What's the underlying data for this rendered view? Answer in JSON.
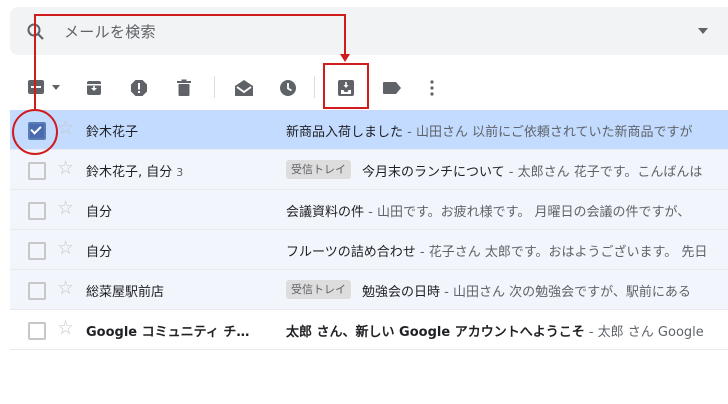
{
  "search": {
    "placeholder": "メールを検索"
  },
  "toolbar": {
    "buttons": [
      "select-all",
      "archive",
      "report-spam",
      "delete",
      "mark-as-read",
      "snooze",
      "move-to-inbox",
      "label",
      "more"
    ]
  },
  "colors": {
    "annotation": "#d01c1c",
    "selected_row": "#c2dbff",
    "read_row": "#f2f6fc"
  },
  "messages": [
    {
      "sender": "鈴木花子",
      "count": "",
      "label": "",
      "subject": "新商品入荷しました",
      "snippet": " - 山田さん 以前にご依頼されていた新商品ですが",
      "state": "selected",
      "checked": true,
      "bold": false
    },
    {
      "sender": "鈴木花子, 自分",
      "count": "3",
      "label": "受信トレイ",
      "subject": "今月末のランチについて",
      "snippet": " - 太郎さん 花子です。こんばんは",
      "state": "read",
      "checked": false,
      "bold": false
    },
    {
      "sender": "自分",
      "count": "",
      "label": "",
      "subject": "会議資料の件",
      "snippet": " - 山田です。お疲れ様です。 月曜日の会議の件ですが、",
      "state": "read",
      "checked": false,
      "bold": false
    },
    {
      "sender": "自分",
      "count": "",
      "label": "",
      "subject": "フルーツの詰め合わせ",
      "snippet": " - 花子さん 太郎です。おはようございます。 先日",
      "state": "read",
      "checked": false,
      "bold": false
    },
    {
      "sender": "総菜屋駅前店",
      "count": "",
      "label": "受信トレイ",
      "subject": "勉強会の日時",
      "snippet": " - 山田さん 次の勉強会ですが、駅前にある",
      "state": "read",
      "checked": false,
      "bold": false
    },
    {
      "sender": "Google コミュニティ チ…",
      "count": "",
      "label": "",
      "subject": "太郎 さん、新しい Google アカウントへようこそ",
      "snippet": " - 太郎 さん Google",
      "state": "unread",
      "checked": false,
      "bold": true
    }
  ]
}
